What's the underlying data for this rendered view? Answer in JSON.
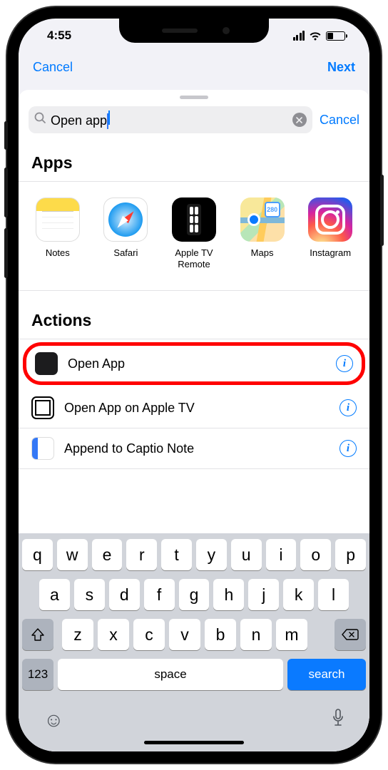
{
  "status": {
    "time": "4:55"
  },
  "backdrop": {
    "cancel": "Cancel",
    "next": "Next"
  },
  "search": {
    "value": "Open app",
    "cancel": "Cancel"
  },
  "sections": {
    "apps": "Apps",
    "actions": "Actions"
  },
  "apps": [
    {
      "label": "Notes"
    },
    {
      "label": "Safari"
    },
    {
      "label": "Apple TV Remote"
    },
    {
      "label": "Maps",
      "badge": "280"
    },
    {
      "label": "Instagram"
    }
  ],
  "actions": [
    {
      "label": "Open App"
    },
    {
      "label": "Open App on Apple TV"
    },
    {
      "label": "Append to Captio Note"
    }
  ],
  "keyboard": {
    "row1": [
      "q",
      "w",
      "e",
      "r",
      "t",
      "y",
      "u",
      "i",
      "o",
      "p"
    ],
    "row2": [
      "a",
      "s",
      "d",
      "f",
      "g",
      "h",
      "j",
      "k",
      "l"
    ],
    "row3": [
      "z",
      "x",
      "c",
      "v",
      "b",
      "n",
      "m"
    ],
    "numKey": "123",
    "space": "space",
    "search": "search"
  }
}
